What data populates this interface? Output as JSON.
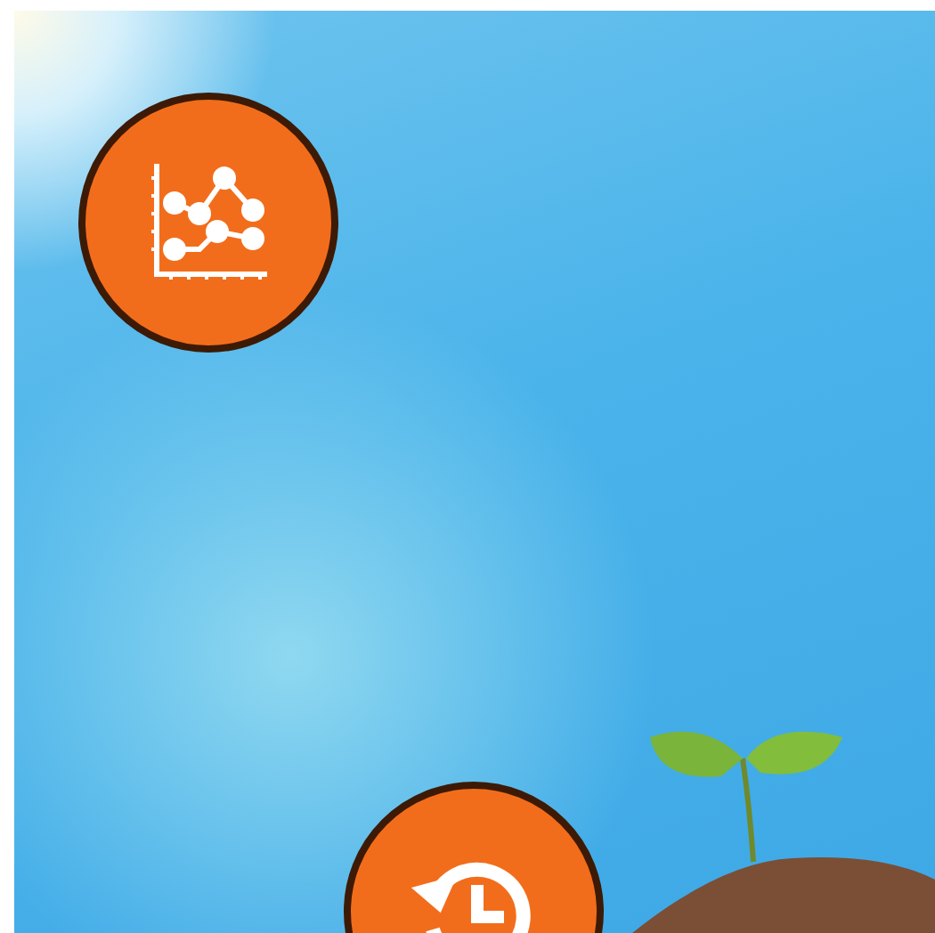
{
  "buttons": [
    {
      "kind": "chart"
    },
    {
      "kind": "history"
    }
  ]
}
